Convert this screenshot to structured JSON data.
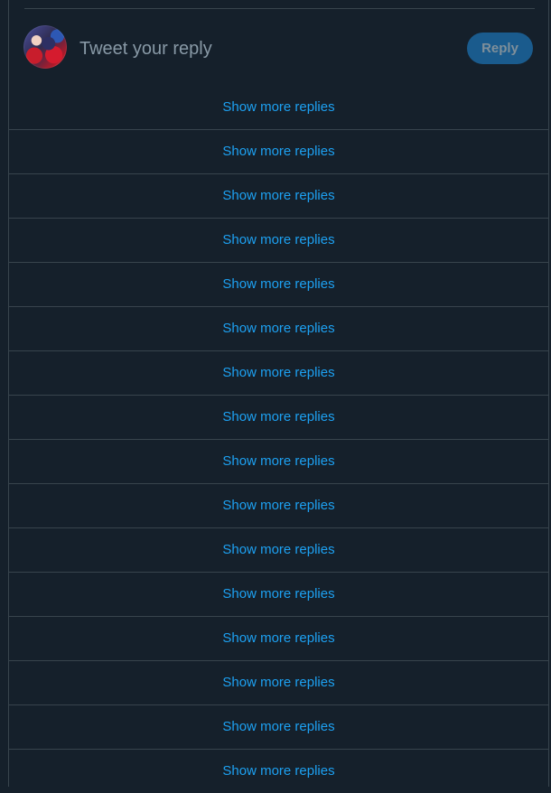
{
  "composer": {
    "placeholder": "Tweet your reply",
    "reply_label": "Reply"
  },
  "replies": {
    "items": [
      "Show more replies",
      "Show more replies",
      "Show more replies",
      "Show more replies",
      "Show more replies",
      "Show more replies",
      "Show more replies",
      "Show more replies",
      "Show more replies",
      "Show more replies",
      "Show more replies",
      "Show more replies",
      "Show more replies",
      "Show more replies",
      "Show more replies",
      "Show more replies"
    ]
  },
  "colors": {
    "background": "#15202b",
    "divider": "#38444d",
    "link": "#1da1f2",
    "placeholder": "#8899a6",
    "reply_button_bg": "#1a5b8d"
  }
}
